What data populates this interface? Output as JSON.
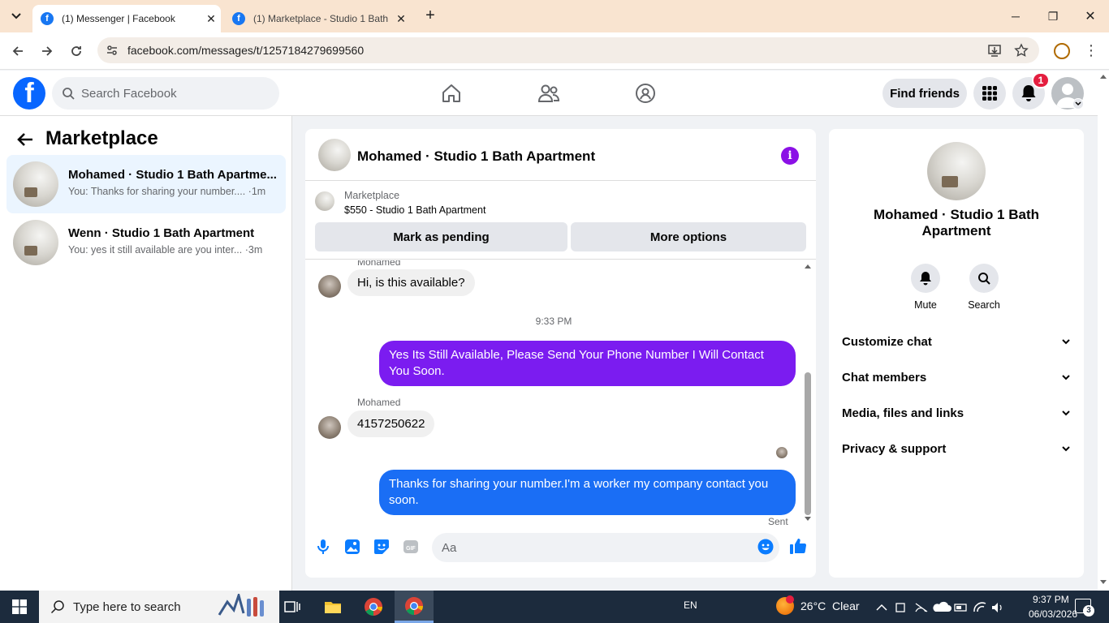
{
  "browser": {
    "tabs": [
      {
        "title": "(1) Messenger | Facebook",
        "active": true
      },
      {
        "title": "(1) Marketplace - Studio 1 Bath",
        "active": false
      }
    ],
    "url": "facebook.com/messages/t/1257184279699560"
  },
  "header": {
    "search_placeholder": "Search Facebook",
    "find_friends": "Find friends",
    "notification_count": "1"
  },
  "sidebar": {
    "title": "Marketplace",
    "conversations": [
      {
        "name": "Mohamed · Studio 1 Bath Apartme...",
        "snippet": "You: Thanks for sharing your number.... ·1m",
        "selected": true
      },
      {
        "name": "Wenn · Studio 1 Bath Apartment",
        "snippet": "You: yes it still available are you inter... ·3m",
        "selected": false
      }
    ]
  },
  "chat": {
    "title": "Mohamed · Studio 1 Bath Apartment",
    "marketplace_label": "Marketplace",
    "listing": "$550 - Studio 1 Bath Apartment",
    "mark_pending": "Mark as pending",
    "more_options": "More options",
    "sender_top": "Mohamed",
    "msg1": "Hi, is this available?",
    "timestamp": "9:33 PM",
    "msg2": "Yes Its Still Available, Please Send Your Phone Number I Will Contact You Soon.",
    "sender2": "Mohamed",
    "msg3": "4157250622",
    "msg4": "Thanks for sharing your number.I'm a worker my company contact you soon.",
    "status": "Sent",
    "input_placeholder": "Aa",
    "colors": {
      "outgoing_purple": "#7b1cf0",
      "outgoing_blue": "#1a6ef5",
      "accent": "#8b10e6"
    }
  },
  "details": {
    "name": "Mohamed · Studio 1 Bath Apartment",
    "mute": "Mute",
    "search": "Search",
    "sections": [
      "Customize chat",
      "Chat members",
      "Media, files and links",
      "Privacy & support"
    ]
  },
  "taskbar": {
    "search_placeholder": "Type here to search",
    "lang": "EN",
    "weather": "26°C  Clear",
    "time": "9:37 PM",
    "date": "06/03/2026",
    "notif_count": "3"
  }
}
